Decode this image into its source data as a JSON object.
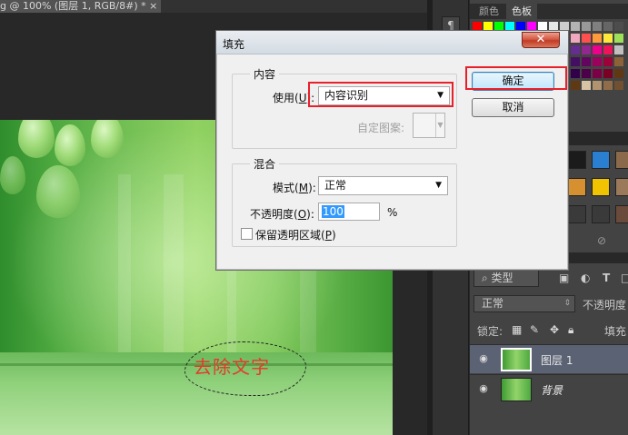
{
  "document": {
    "tab_title": "g @ 100% (图层 1, RGB/8#) * ×",
    "canvas_text": "去除文字"
  },
  "panels": {
    "color_tab": "颜色",
    "swatches_tab": "色板",
    "layers": {
      "filter_kind": "类型",
      "blend_mode": "正常",
      "opacity_label": "不透明度",
      "lock_label": "锁定:",
      "fill_label": "填充",
      "items": [
        {
          "name": "图层 1",
          "selected": true
        },
        {
          "name": "背景",
          "selected": false
        }
      ]
    }
  },
  "dialog": {
    "title": "填充",
    "close_symbol": "✕",
    "contents": {
      "group_label": "内容",
      "use_label": "使用",
      "use_shortcut": "U",
      "use_value": "内容识别",
      "custom_pattern_label": "自定图案:"
    },
    "blending": {
      "group_label": "混合",
      "mode_label": "模式",
      "mode_shortcut": "M",
      "mode_value": "正常",
      "opacity_label": "不透明度",
      "opacity_shortcut": "O",
      "opacity_value": "100",
      "opacity_unit": "%",
      "preserve_label": "保留透明区域",
      "preserve_shortcut": "P",
      "preserve_checked": false
    },
    "ok_label": "确定",
    "cancel_label": "取消"
  },
  "colors": {
    "highlight": "#e8202a",
    "selection_text": "#e43a2a"
  }
}
